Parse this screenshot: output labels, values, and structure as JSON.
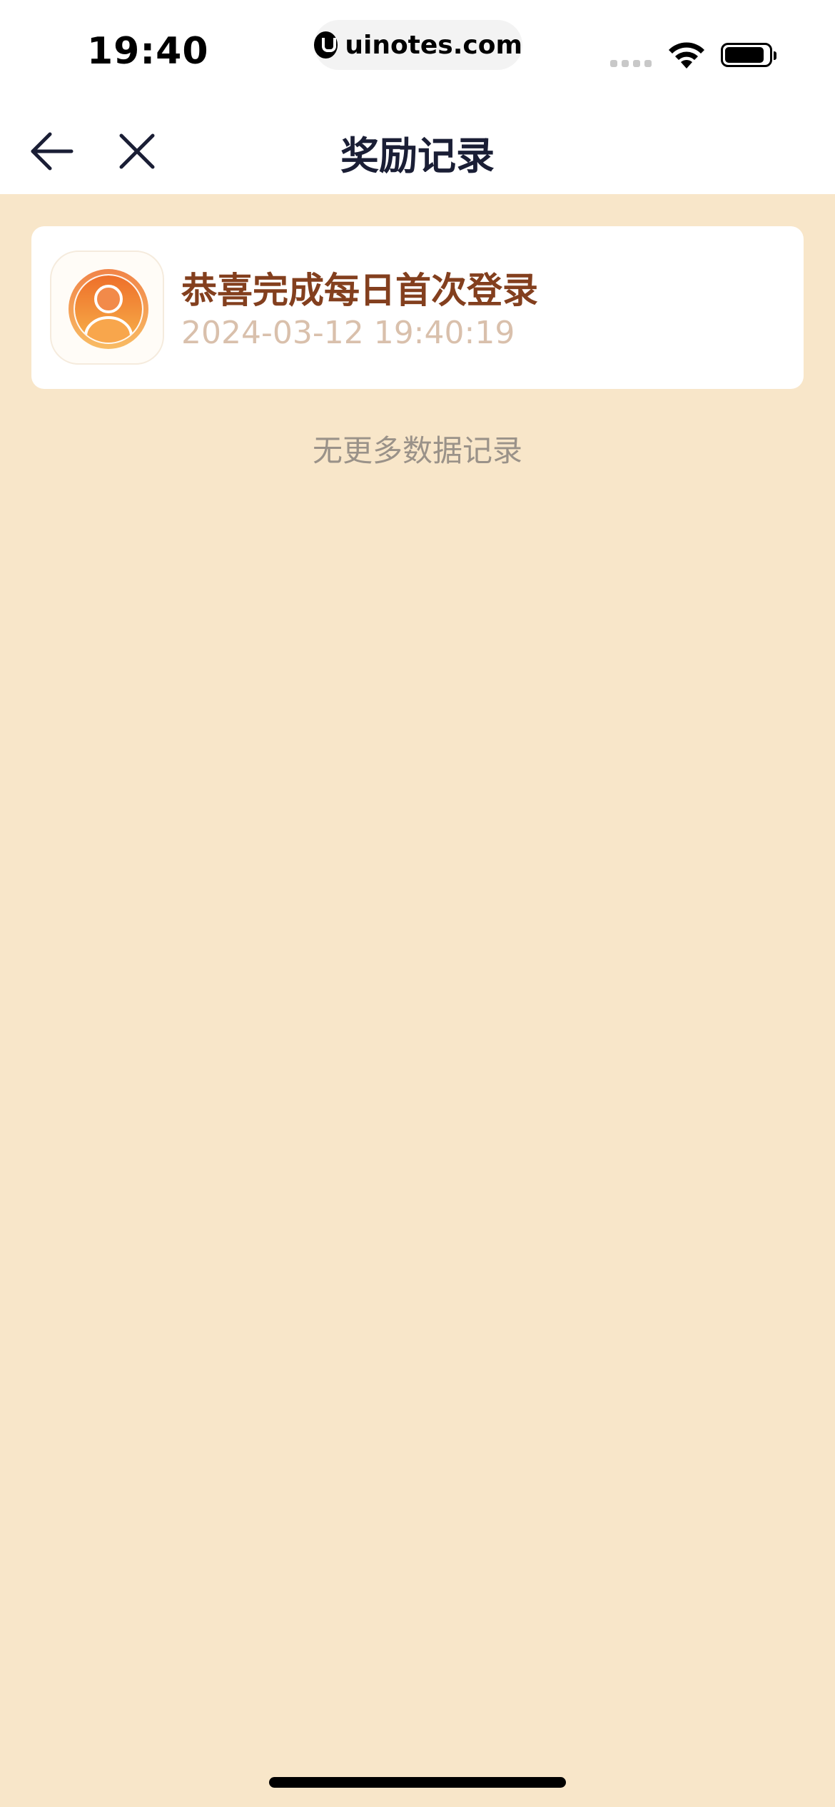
{
  "status_bar": {
    "time": "19:40",
    "url": "uinotes.com",
    "icons": [
      "cellular-signal-icon",
      "wifi-icon",
      "battery-icon"
    ]
  },
  "nav": {
    "title": "奖励记录",
    "back_icon": "arrow-left-icon",
    "close_icon": "close-icon"
  },
  "records": [
    {
      "icon": "user-avatar-icon",
      "title": "恭喜完成每日首次登录",
      "time": "2024-03-12 19:40:19"
    }
  ],
  "footer_text": "无更多数据记录",
  "colors": {
    "background": "#F8E6C9",
    "title_text": "#1A1E35",
    "record_title": "#833F1E",
    "record_time": "#D9C0AC",
    "muted_text": "#9A9289",
    "avatar_gradient_top": "#EE6F2A",
    "avatar_gradient_bottom": "#F7B04A"
  }
}
